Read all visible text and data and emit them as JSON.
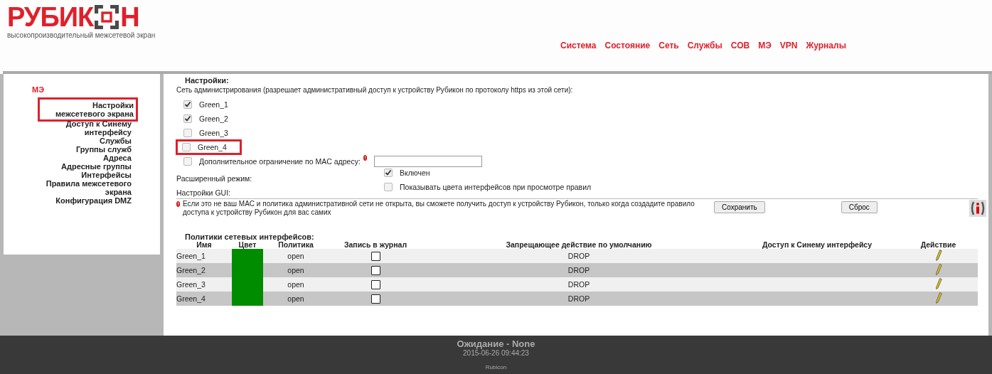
{
  "logo": {
    "text_before": "РУБИК",
    "text_after": "Н",
    "tagline": "высокопроизводительный межсетевой экран"
  },
  "nav": [
    {
      "label": "Система"
    },
    {
      "label": "Состояние"
    },
    {
      "label": "Сеть"
    },
    {
      "label": "Службы"
    },
    {
      "label": "СОВ"
    },
    {
      "label": "МЭ"
    },
    {
      "label": "VPN"
    },
    {
      "label": "Журналы"
    }
  ],
  "sidebar": {
    "title": "МЭ",
    "items": [
      {
        "label": "Настройки межсетевого экрана",
        "highlighted": true
      },
      {
        "label": "Доступ к Синему интерфейсу",
        "highlighted": false
      },
      {
        "label": "Службы",
        "highlighted": false
      },
      {
        "label": "Группы служб",
        "highlighted": false
      },
      {
        "label": "Адреса",
        "highlighted": false
      },
      {
        "label": "Адресные группы",
        "highlighted": false
      },
      {
        "label": "Интерфейсы",
        "highlighted": false
      },
      {
        "label": "Правила межсетевого экрана",
        "highlighted": false
      },
      {
        "label": "Конфигурация DMZ",
        "highlighted": false
      }
    ]
  },
  "settings": {
    "title": "Настройки:",
    "admin_network_label": "Сеть администрирования (разрешает административный доступ к устройству Рубикон по протоколу https из этой сети):",
    "networks": [
      {
        "label": "Green_1",
        "checked": true,
        "highlighted": false
      },
      {
        "label": "Green_2",
        "checked": true,
        "highlighted": false
      },
      {
        "label": "Green_3",
        "checked": false,
        "highlighted": false
      },
      {
        "label": "Green_4",
        "checked": false,
        "highlighted": true
      }
    ],
    "mac_restriction": {
      "label": "Дополнительное ограничение по MAC адресу:",
      "checked": false
    },
    "advanced_mode": {
      "label": "Расширенный режим:",
      "option": "Включен",
      "checked": true
    },
    "gui": {
      "label": "Настройки GUI:",
      "option": "Показывать цвета интерфейсов при просмотре правил",
      "checked": false
    },
    "warning": "Если это не ваш MAC и политика административной сети не открыта, вы сможете получить доступ к устройству Рубикон, только когда создадите правило доступа к устройству Рубикон для вас самих",
    "buttons": [
      "Сохранить",
      "Сброс"
    ]
  },
  "policies": {
    "title": "Политики сетевых интерфейсов:",
    "columns": [
      "Имя",
      "Цвет",
      "Политика",
      "Запись в журнал",
      "Запрещающее действие по умолчанию",
      "Доступ к Синему интерфейсу",
      "Действие"
    ],
    "rows": [
      {
        "name": "Green_1",
        "color": "#008c00",
        "policy": "open",
        "log": false,
        "default_action": "DROP"
      },
      {
        "name": "Green_2",
        "color": "#008c00",
        "policy": "open",
        "log": false,
        "default_action": "DROP"
      },
      {
        "name": "Green_3",
        "color": "#008c00",
        "policy": "open",
        "log": false,
        "default_action": "DROP"
      },
      {
        "name": "Green_4",
        "color": "#008c00",
        "policy": "open",
        "log": false,
        "default_action": "DROP"
      }
    ]
  },
  "footer": {
    "status": "Ожидание - None",
    "timestamp": "2015-06-26 09:44:23",
    "brand": "Rubicon"
  }
}
